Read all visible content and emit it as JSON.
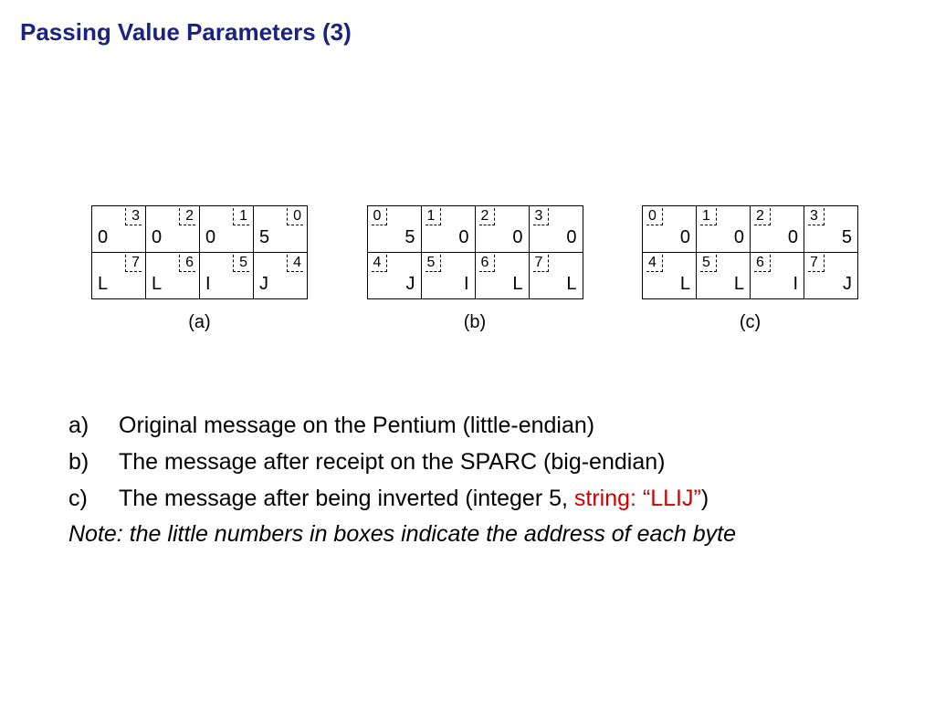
{
  "title": "Passing Value Parameters (3)",
  "blocks": [
    {
      "caption": "(a)",
      "addrSide": "right",
      "valAlign": "left",
      "rows": [
        {
          "cells": [
            {
              "addr": "3",
              "val": "0"
            },
            {
              "addr": "2",
              "val": "0"
            },
            {
              "addr": "1",
              "val": "0"
            },
            {
              "addr": "0",
              "val": "5"
            }
          ]
        },
        {
          "cells": [
            {
              "addr": "7",
              "val": "L"
            },
            {
              "addr": "6",
              "val": "L"
            },
            {
              "addr": "5",
              "val": "I"
            },
            {
              "addr": "4",
              "val": "J"
            }
          ]
        }
      ]
    },
    {
      "caption": "(b)",
      "addrSide": "left",
      "valAlign": "right",
      "rows": [
        {
          "cells": [
            {
              "addr": "0",
              "val": "5"
            },
            {
              "addr": "1",
              "val": "0"
            },
            {
              "addr": "2",
              "val": "0"
            },
            {
              "addr": "3",
              "val": "0"
            }
          ]
        },
        {
          "cells": [
            {
              "addr": "4",
              "val": "J"
            },
            {
              "addr": "5",
              "val": "I"
            },
            {
              "addr": "6",
              "val": "L"
            },
            {
              "addr": "7",
              "val": "L"
            }
          ]
        }
      ]
    },
    {
      "caption": "(c)",
      "addrSide": "left",
      "valAlign": "right",
      "rows": [
        {
          "cells": [
            {
              "addr": "0",
              "val": "0"
            },
            {
              "addr": "1",
              "val": "0"
            },
            {
              "addr": "2",
              "val": "0"
            },
            {
              "addr": "3",
              "val": "5"
            }
          ]
        },
        {
          "cells": [
            {
              "addr": "4",
              "val": "L"
            },
            {
              "addr": "5",
              "val": "L"
            },
            {
              "addr": "6",
              "val": "I"
            },
            {
              "addr": "7",
              "val": "J"
            }
          ]
        }
      ]
    }
  ],
  "list": {
    "a": {
      "marker": "a)",
      "text": "Original message on the Pentium (little-endian)"
    },
    "b": {
      "marker": "b)",
      "text": "The message after receipt on the SPARC (big-endian)"
    },
    "c": {
      "marker": "c)",
      "pre": "The message after being inverted (integer 5, ",
      "red": "string: “LLIJ”",
      "post": ")"
    }
  },
  "note": "Note: the little numbers in boxes indicate the address of each byte"
}
